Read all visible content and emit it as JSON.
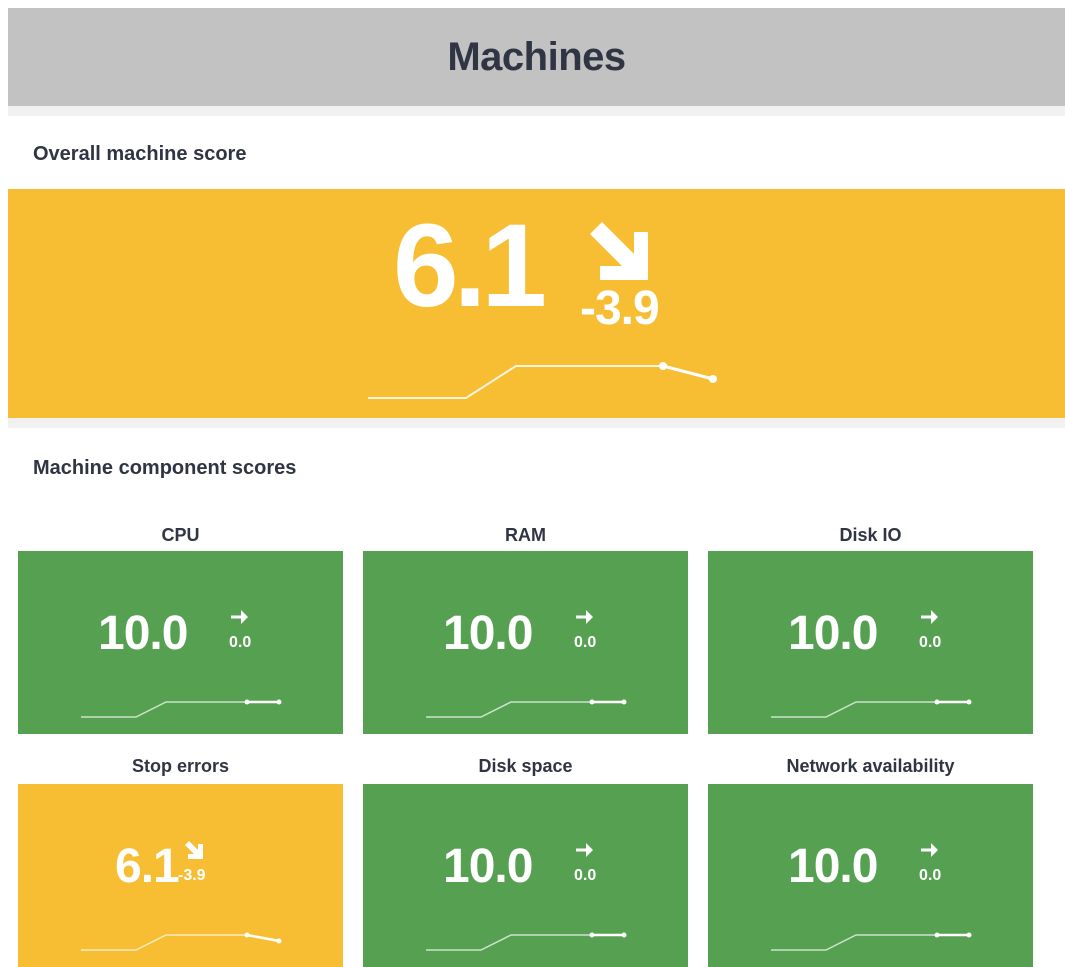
{
  "page": {
    "title": "Machines",
    "colors": {
      "header": "#c2c2c2",
      "warning": "#f7be34",
      "good": "#56a052",
      "text": "#2f3542"
    }
  },
  "overall": {
    "section_title": "Overall machine score",
    "score": "6.1",
    "delta": "-3.9",
    "trend_icon": "arrow-down-right-icon",
    "status": "warning"
  },
  "components": {
    "section_title": "Machine component scores",
    "items": [
      {
        "label": "CPU",
        "score": "10.0",
        "delta": "0.0",
        "trend_icon": "arrow-right-icon",
        "status": "good"
      },
      {
        "label": "RAM",
        "score": "10.0",
        "delta": "0.0",
        "trend_icon": "arrow-right-icon",
        "status": "good"
      },
      {
        "label": "Disk IO",
        "score": "10.0",
        "delta": "0.0",
        "trend_icon": "arrow-right-icon",
        "status": "good"
      },
      {
        "label": "Stop errors",
        "score": "6.1",
        "delta": "-3.9",
        "trend_icon": "arrow-down-right-icon",
        "status": "warning"
      },
      {
        "label": "Disk space",
        "score": "10.0",
        "delta": "0.0",
        "trend_icon": "arrow-right-icon",
        "status": "good"
      },
      {
        "label": "Network availability",
        "score": "10.0",
        "delta": "0.0",
        "trend_icon": "arrow-right-icon",
        "status": "good"
      }
    ]
  }
}
